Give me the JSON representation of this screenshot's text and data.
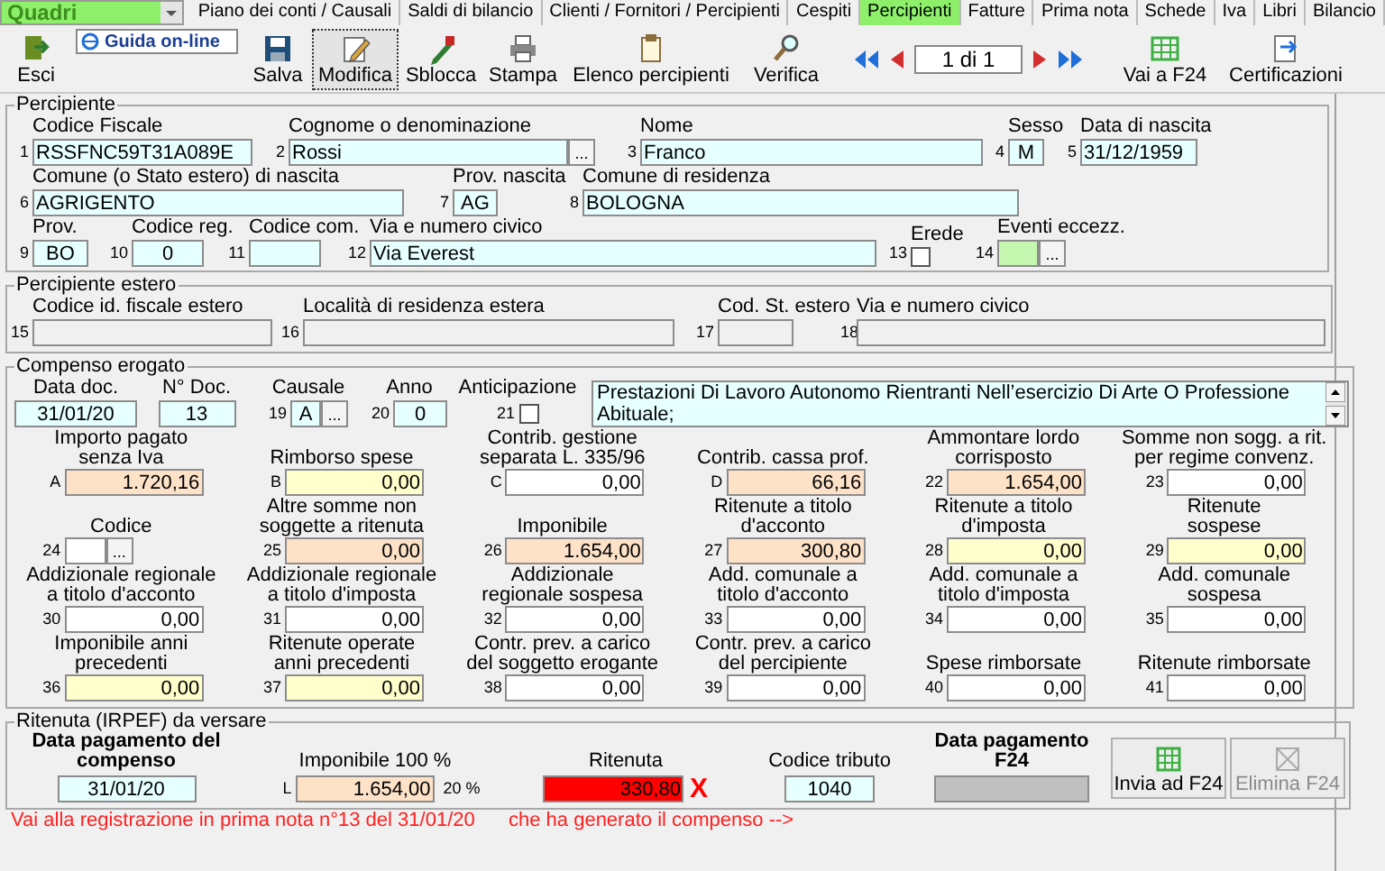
{
  "module_selector": {
    "value": "Quadri"
  },
  "tabs": [
    {
      "label": "Piano dei conti / Causali",
      "selected": false
    },
    {
      "label": "Saldi di bilancio",
      "selected": false
    },
    {
      "label": "Clienti / Fornitori / Percipienti",
      "selected": false
    },
    {
      "label": "Cespiti",
      "selected": false
    },
    {
      "label": "Percipienti",
      "selected": true
    },
    {
      "label": "Fatture",
      "selected": false
    },
    {
      "label": "Prima nota",
      "selected": false
    },
    {
      "label": "Schede",
      "selected": false
    },
    {
      "label": "Iva",
      "selected": false
    },
    {
      "label": "Libri",
      "selected": false
    },
    {
      "label": "Bilancio",
      "selected": false
    }
  ],
  "toolbar": {
    "exit": {
      "label": "Esci",
      "pressed": false
    },
    "guide_link": "Guida on-line",
    "buttons": [
      {
        "label": "Salva",
        "kind": "save",
        "pressed": false
      },
      {
        "label": "Modifica",
        "kind": "edit",
        "pressed": true
      },
      {
        "label": "Sblocca",
        "kind": "unlock",
        "pressed": false
      },
      {
        "label": "Stampa",
        "kind": "print",
        "pressed": false
      },
      {
        "label": "Elenco percipienti",
        "kind": "list",
        "pressed": false
      },
      {
        "label": "Verifica",
        "kind": "search",
        "pressed": false
      }
    ],
    "pager": {
      "text": "1 di 1"
    },
    "right_buttons": [
      {
        "label": "Vai a F24",
        "kind": "f24",
        "pressed": false
      },
      {
        "label": "Certificazioni",
        "kind": "cert",
        "pressed": false
      }
    ]
  },
  "percipiente": {
    "title": "Percipiente",
    "fields": [
      {
        "num": "1",
        "label": "Codice Fiscale",
        "value": "RSSFNC59T31A089E",
        "color": "#e6ffff",
        "kind": "text"
      },
      {
        "num": "2",
        "label": "Cognome o denominazione",
        "value": "Rossi",
        "color": "#e6ffff",
        "kind": "lookup",
        "button": "..."
      },
      {
        "num": "3",
        "label": "Nome",
        "value": "Franco",
        "color": "#e6ffff",
        "kind": "text"
      },
      {
        "num": "4",
        "label": "Sesso",
        "value": "M",
        "color": "#e6ffff",
        "kind": "text"
      },
      {
        "num": "5",
        "label": "Data di nascita",
        "value": "31/12/1959",
        "color": "#e6ffff",
        "kind": "text"
      },
      {
        "num": "6",
        "label": "Comune (o Stato estero) di nascita",
        "value": "AGRIGENTO",
        "color": "#e6ffff",
        "kind": "text"
      },
      {
        "num": "7",
        "label": "Prov. nascita",
        "value": "AG",
        "color": "#e6ffff",
        "kind": "text"
      },
      {
        "num": "8",
        "label": "Comune di residenza",
        "value": "BOLOGNA",
        "color": "#e6ffff",
        "kind": "text"
      },
      {
        "num": "9",
        "label": "Prov.",
        "value": "BO",
        "color": "#e6ffff",
        "kind": "text"
      },
      {
        "num": "10",
        "label": "Codice reg.",
        "value": "0",
        "color": "#e6ffff",
        "kind": "text"
      },
      {
        "num": "11",
        "label": "Codice com.",
        "color": "#e6ffff",
        "kind": "text"
      },
      {
        "num": "12",
        "label": "Via e numero civico",
        "value": "Via Everest",
        "color": "#e6ffff",
        "kind": "text"
      },
      {
        "num": "13",
        "label": "Erede",
        "kind": "checkbox",
        "checked": false
      },
      {
        "num": "14",
        "label": "Eventi eccezz.",
        "color": "#c6f7b0",
        "kind": "lookup",
        "button": "..."
      }
    ]
  },
  "percipiente_estero": {
    "title": "Percipiente estero",
    "fields": [
      {
        "num": "15",
        "label": "Codice id. fiscale estero",
        "kind": "text"
      },
      {
        "num": "16",
        "label": "Località di residenza estera",
        "kind": "text"
      },
      {
        "num": "17",
        "label": "Cod. St. estero",
        "kind": "text"
      },
      {
        "num": "18",
        "label": "Via e numero civico",
        "kind": "text"
      }
    ]
  },
  "compenso": {
    "title": "Compenso erogato",
    "top": [
      {
        "label": "Data doc.",
        "value": "31/01/20",
        "color": "#e6ffff",
        "kind": "text"
      },
      {
        "label": "N° Doc.",
        "value": "13",
        "color": "#e6ffff",
        "kind": "text"
      },
      {
        "num": "19",
        "label": "Causale",
        "value": "A",
        "color": "#e6ffff",
        "kind": "lookup",
        "button": "..."
      },
      {
        "num": "20",
        "label": "Anno",
        "value": "0",
        "color": "#e6ffff",
        "kind": "text"
      },
      {
        "num": "21",
        "label": "Anticipazione",
        "kind": "checkbox",
        "checked": false
      }
    ],
    "description": "Prestazioni Di Lavoro Autonomo Rientranti Nell’esercizio Di Arte O Professione Abituale;",
    "grid": [
      {
        "num": "A",
        "label": "Importo pagato\nsenza Iva",
        "value": "1.720,16",
        "color": "#fde2c8",
        "kind": "text"
      },
      {
        "num": "B",
        "label": "Rimborso spese",
        "value": "0,00",
        "color": "#ffffcc",
        "kind": "text"
      },
      {
        "num": "C",
        "label": "Contrib. gestione\nseparata L. 335/96",
        "value": "0,00",
        "color": "#ffffff",
        "kind": "text"
      },
      {
        "num": "D",
        "label": "Contrib. cassa prof.",
        "value": "66,16",
        "color": "#fde2c8",
        "kind": "text"
      },
      {
        "num": "22",
        "label": "Ammontare lordo\ncorrisposto",
        "value": "1.654,00",
        "color": "#fde2c8",
        "kind": "text"
      },
      {
        "num": "23",
        "label": "Somme non sogg. a rit.\nper regime convenz.",
        "value": "0,00",
        "color": "#ffffff",
        "kind": "text"
      },
      {
        "num": "24",
        "label": "Codice",
        "color": "#ffffff",
        "kind": "lookup",
        "button": "..."
      },
      {
        "num": "25",
        "label": "Altre somme non\nsoggette a ritenuta",
        "value": "0,00",
        "color": "#fde2c8",
        "kind": "text"
      },
      {
        "num": "26",
        "label": "Imponibile",
        "value": "1.654,00",
        "color": "#fde2c8",
        "kind": "text"
      },
      {
        "num": "27",
        "label": "Ritenute a titolo\nd'acconto",
        "value": "300,80",
        "color": "#fde2c8",
        "kind": "text"
      },
      {
        "num": "28",
        "label": "Ritenute a titolo\nd'imposta",
        "value": "0,00",
        "color": "#ffffcc",
        "kind": "text"
      },
      {
        "num": "29",
        "label": "Ritenute\nsospese",
        "value": "0,00",
        "color": "#ffffcc",
        "kind": "text"
      },
      {
        "num": "30",
        "label": "Addizionale regionale\na titolo d'acconto",
        "value": "0,00",
        "color": "#ffffff",
        "kind": "text"
      },
      {
        "num": "31",
        "label": "Addizionale regionale\na titolo d'imposta",
        "value": "0,00",
        "color": "#ffffff",
        "kind": "text"
      },
      {
        "num": "32",
        "label": "Addizionale\nregionale sospesa",
        "value": "0,00",
        "color": "#ffffff",
        "kind": "text"
      },
      {
        "num": "33",
        "label": "Add. comunale a\ntitolo d'acconto",
        "value": "0,00",
        "color": "#ffffff",
        "kind": "text"
      },
      {
        "num": "34",
        "label": "Add. comunale a\ntitolo d'imposta",
        "value": "0,00",
        "color": "#ffffff",
        "kind": "text"
      },
      {
        "num": "35",
        "label": "Add. comunale\nsospesa",
        "value": "0,00",
        "color": "#ffffff",
        "kind": "text"
      },
      {
        "num": "36",
        "label": "Imponibile anni\nprecedenti",
        "value": "0,00",
        "color": "#ffffcc",
        "kind": "text"
      },
      {
        "num": "37",
        "label": "Ritenute operate\nanni precedenti",
        "value": "0,00",
        "color": "#ffffcc",
        "kind": "text"
      },
      {
        "num": "38",
        "label": "Contr. prev. a carico\ndel soggetto erogante",
        "value": "0,00",
        "color": "#ffffff",
        "kind": "text"
      },
      {
        "num": "39",
        "label": "Contr. prev. a carico\ndel percipiente",
        "value": "0,00",
        "color": "#ffffff",
        "kind": "text"
      },
      {
        "num": "40",
        "label": "Spese rimborsate",
        "value": "0,00",
        "color": "#ffffff",
        "kind": "text"
      },
      {
        "num": "41",
        "label": "Ritenute rimborsate",
        "value": "0,00",
        "color": "#ffffff",
        "kind": "text"
      }
    ]
  },
  "ritenuta": {
    "title": "Ritenuta (IRPEF) da versare",
    "fields": [
      {
        "label": "Data pagamento del\ncompenso",
        "value": "31/01/20",
        "color": "#e6ffff",
        "kind": "text"
      },
      {
        "num": "L",
        "label": "Imponibile 100 %",
        "value": "1.654,00",
        "color": "#fde2c8",
        "kind": "text",
        "suffix": "20 %"
      },
      {
        "label": "Ritenuta",
        "value": "330,80",
        "color": "#ff0000",
        "kind": "text",
        "flag": "X"
      },
      {
        "label": "Codice tributo",
        "value": "1040",
        "color": "#e6ffff",
        "kind": "text"
      },
      {
        "label": "Data pagamento\nF24",
        "color": "#c0c0c0",
        "kind": "text"
      }
    ],
    "buttons": [
      {
        "label": "Invia ad F24",
        "disabled": false
      },
      {
        "label": "Elimina F24",
        "disabled": true
      }
    ]
  },
  "footer_links": [
    "Vai alla registrazione in prima nota n°13 del 31/01/20",
    "che ha generato il compenso -->"
  ]
}
